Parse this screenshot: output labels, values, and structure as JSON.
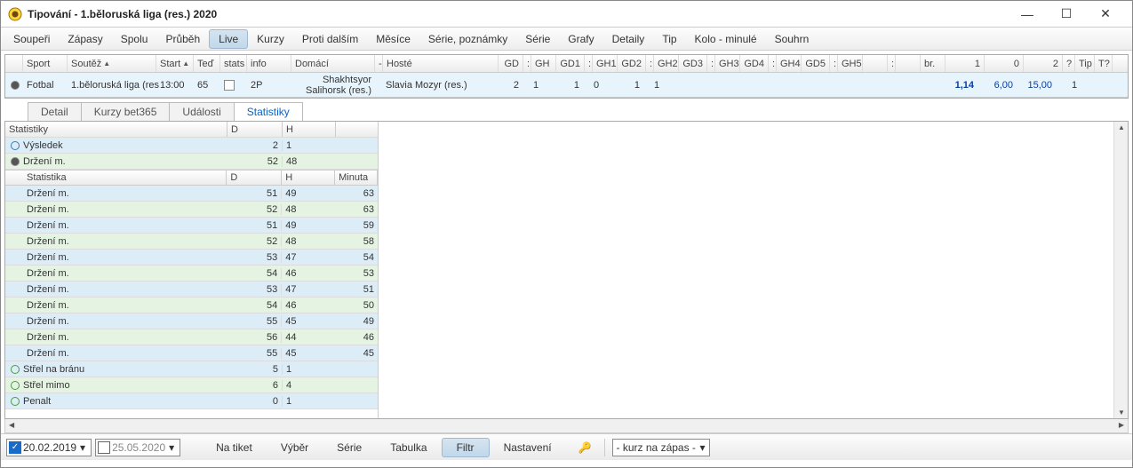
{
  "window": {
    "title": "Tipování - 1.běloruská liga (res.) 2020"
  },
  "menu": {
    "items": [
      "Soupeři",
      "Zápasy",
      "Spolu",
      "Průběh",
      "Live",
      "Kurzy",
      "Proti dalším",
      "Měsíce",
      "Série, poznámky",
      "Série",
      "Grafy",
      "Detaily",
      "Tip",
      "Kolo - minulé",
      "Souhrn"
    ],
    "active_index": 4
  },
  "grid": {
    "columns": [
      "Sport",
      "Soutěž",
      "Start",
      "Teď",
      "stats",
      "info",
      "Domácí",
      "-",
      "Hosté",
      "GD",
      ":",
      "GH",
      "GD1",
      ":",
      "GH1",
      "GD2",
      ":",
      "GH2",
      "GD3",
      ":",
      "GH3",
      "GD4",
      ":",
      "GH4",
      "GD5",
      ":",
      "GH5",
      "",
      ":",
      "",
      "br.",
      "1",
      "0",
      "2",
      "?",
      "Tip",
      "T?"
    ],
    "row": {
      "sport": "Fotbal",
      "soutez": "1.běloruská liga (res",
      "start": "13:00",
      "ted": "65",
      "info": "2P",
      "domaci_l1": "Shakhtsyor",
      "domaci_l2": "Salihorsk (res.)",
      "hoste": "Slavia Mozyr (res.)",
      "gd": "2",
      "gh": "1",
      "gd1": "1",
      "gh1": "0",
      "gd2": "1",
      "gh2": "1",
      "o1": "1,14",
      "o0": "6,00",
      "o2": "15,00",
      "tip": "1"
    }
  },
  "tabs": {
    "items": [
      "Detail",
      "Kurzy bet365",
      "Události",
      "Statistiky"
    ],
    "active_index": 3
  },
  "stats": {
    "header": {
      "name": "Statistiky",
      "d": "D",
      "h": "H"
    },
    "summary": [
      {
        "name": "Výsledek",
        "d": "2",
        "h": "1",
        "color": "blue",
        "icon": "blue"
      },
      {
        "name": "Držení m.",
        "d": "52",
        "h": "48",
        "color": "green",
        "icon": "filled"
      }
    ],
    "inner_header": {
      "name": "Statistika",
      "d": "D",
      "h": "H",
      "min": "Minuta"
    },
    "detail": [
      {
        "name": "Držení m.",
        "d": "51",
        "h": "49",
        "min": "63"
      },
      {
        "name": "Držení m.",
        "d": "52",
        "h": "48",
        "min": "63"
      },
      {
        "name": "Držení m.",
        "d": "51",
        "h": "49",
        "min": "59"
      },
      {
        "name": "Držení m.",
        "d": "52",
        "h": "48",
        "min": "58"
      },
      {
        "name": "Držení m.",
        "d": "53",
        "h": "47",
        "min": "54"
      },
      {
        "name": "Držení m.",
        "d": "54",
        "h": "46",
        "min": "53"
      },
      {
        "name": "Držení m.",
        "d": "53",
        "h": "47",
        "min": "51"
      },
      {
        "name": "Držení m.",
        "d": "54",
        "h": "46",
        "min": "50"
      },
      {
        "name": "Držení m.",
        "d": "55",
        "h": "45",
        "min": "49"
      },
      {
        "name": "Držení m.",
        "d": "56",
        "h": "44",
        "min": "46"
      },
      {
        "name": "Držení m.",
        "d": "55",
        "h": "45",
        "min": "45"
      }
    ],
    "footer": [
      {
        "name": "Střel na bránu",
        "d": "5",
        "h": "1",
        "color": "blue",
        "icon": "green"
      },
      {
        "name": "Střel mimo",
        "d": "6",
        "h": "4",
        "color": "green",
        "icon": "green"
      },
      {
        "name": "Penalt",
        "d": "0",
        "h": "1",
        "color": "blue",
        "icon": "green"
      }
    ]
  },
  "bottom": {
    "date_from": "20.02.2019",
    "date_to": "25.05.2020",
    "buttons": [
      "Na tiket",
      "Výběr",
      "Série",
      "Tabulka",
      "Filtr",
      "Nastavení"
    ],
    "active_button": 4,
    "select": "- kurz na zápas -"
  }
}
